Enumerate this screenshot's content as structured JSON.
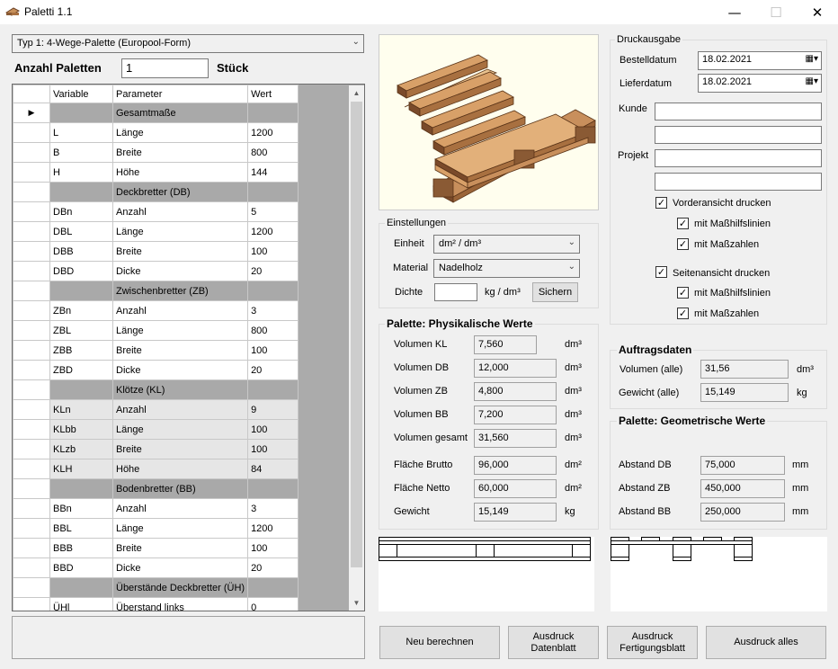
{
  "window": {
    "title": "Paletti 1.1",
    "minimize": "—",
    "maximize": "☐",
    "close": "✕"
  },
  "type_select": {
    "value": "Typ 1: 4-Wege-Palette (Europool-Form)"
  },
  "count": {
    "label": "Anzahl Paletten",
    "value": "1",
    "unit": "Stück"
  },
  "grid": {
    "headers": [
      "Variable",
      "Parameter",
      "Wert"
    ],
    "current_marker": "▶",
    "rows": [
      {
        "kind": "section",
        "title": "Gesamtmaße",
        "current": true
      },
      {
        "kind": "data",
        "var": "L",
        "param": "Länge",
        "val": "1200"
      },
      {
        "kind": "data",
        "var": "B",
        "param": "Breite",
        "val": "800"
      },
      {
        "kind": "data",
        "var": "H",
        "param": "Höhe",
        "val": "144"
      },
      {
        "kind": "section",
        "title": "Deckbretter (DB)"
      },
      {
        "kind": "data",
        "var": "DBn",
        "param": "Anzahl",
        "val": "5"
      },
      {
        "kind": "data",
        "var": "DBL",
        "param": "Länge",
        "val": "1200"
      },
      {
        "kind": "data",
        "var": "DBB",
        "param": "Breite",
        "val": "100"
      },
      {
        "kind": "data",
        "var": "DBD",
        "param": "Dicke",
        "val": "20"
      },
      {
        "kind": "section",
        "title": "Zwischenbretter (ZB)"
      },
      {
        "kind": "data",
        "var": "ZBn",
        "param": "Anzahl",
        "val": "3"
      },
      {
        "kind": "data",
        "var": "ZBL",
        "param": "Länge",
        "val": "800"
      },
      {
        "kind": "data",
        "var": "ZBB",
        "param": "Breite",
        "val": "100"
      },
      {
        "kind": "data",
        "var": "ZBD",
        "param": "Dicke",
        "val": "20"
      },
      {
        "kind": "section",
        "title": "Klötze (KL)"
      },
      {
        "kind": "data",
        "var": "KLn",
        "param": "Anzahl",
        "val": "9",
        "alt": true
      },
      {
        "kind": "data",
        "var": "KLbb",
        "param": "Länge",
        "val": "100",
        "alt": true
      },
      {
        "kind": "data",
        "var": "KLzb",
        "param": "Breite",
        "val": "100",
        "alt": true
      },
      {
        "kind": "data",
        "var": "KLH",
        "param": "Höhe",
        "val": "84",
        "alt": true
      },
      {
        "kind": "section",
        "title": "Bodenbretter (BB)"
      },
      {
        "kind": "data",
        "var": "BBn",
        "param": "Anzahl",
        "val": "3"
      },
      {
        "kind": "data",
        "var": "BBL",
        "param": "Länge",
        "val": "1200"
      },
      {
        "kind": "data",
        "var": "BBB",
        "param": "Breite",
        "val": "100"
      },
      {
        "kind": "data",
        "var": "BBD",
        "param": "Dicke",
        "val": "20"
      },
      {
        "kind": "section",
        "title": "Überstände Deckbretter (ÜH)"
      },
      {
        "kind": "data",
        "var": "ÜHl",
        "param": "Überstand links",
        "val": "0"
      }
    ],
    "scroll_up": "▲",
    "scroll_down": "▼"
  },
  "settings": {
    "title": "Einstellungen",
    "unit_label": "Einheit",
    "unit_value": "dm² / dm³",
    "material_label": "Material",
    "material_value": "Nadelholz",
    "density_label": "Dichte",
    "density_value": "",
    "density_unit": "kg / dm³",
    "save_button": "Sichern"
  },
  "physical": {
    "title": "Palette: Physikalische Werte",
    "rows": [
      {
        "label": "Volumen KL",
        "value": "7,560",
        "unit": "dm³"
      },
      {
        "label": "Volumen DB",
        "value": "12,000",
        "unit": "dm³"
      },
      {
        "label": "Volumen ZB",
        "value": "4,800",
        "unit": "dm³"
      },
      {
        "label": "Volumen BB",
        "value": "7,200",
        "unit": "dm³"
      },
      {
        "label": "Volumen gesamt",
        "value": "31,560",
        "unit": "dm³"
      },
      {
        "label": "Fläche Brutto",
        "value": "96,000",
        "unit": "dm²"
      },
      {
        "label": "Fläche Netto",
        "value": "60,000",
        "unit": "dm²"
      },
      {
        "label": "Gewicht",
        "value": "15,149",
        "unit": "kg"
      }
    ]
  },
  "print": {
    "title": "Druckausgabe",
    "order_date_label": "Bestelldatum",
    "order_date": "18.02.2021",
    "delivery_date_label": "Lieferdatum",
    "delivery_date": "18.02.2021",
    "customer_label": "Kunde",
    "project_label": "Projekt",
    "front_view": "Vorderansicht drucken",
    "side_view": "Seitenansicht drucken",
    "dim_lines": "mit Maßhilfslinien",
    "dim_numbers": "mit Maßzahlen",
    "check": "✓"
  },
  "order": {
    "title": "Auftragsdaten",
    "volume_label": "Volumen (alle)",
    "volume_value": "31,56",
    "volume_unit": "dm³",
    "weight_label": "Gewicht (alle)",
    "weight_value": "15,149",
    "weight_unit": "kg"
  },
  "geometry": {
    "title": "Palette: Geometrische Werte",
    "rows": [
      {
        "label": "Abstand DB",
        "value": "75,000",
        "unit": "mm"
      },
      {
        "label": "Abstand ZB",
        "value": "450,000",
        "unit": "mm"
      },
      {
        "label": "Abstand BB",
        "value": "250,000",
        "unit": "mm"
      }
    ]
  },
  "buttons": {
    "recalc": "Neu berechnen",
    "print_data_1": "Ausdruck",
    "print_data_2": "Datenblatt",
    "print_prod_1": "Ausdruck",
    "print_prod_2": "Fertigungsblatt",
    "print_all": "Ausdruck alles"
  },
  "colors": {
    "wood_light": "#d8a068",
    "wood_dark": "#7a4a2a",
    "section_row": "#a9a9a9"
  }
}
